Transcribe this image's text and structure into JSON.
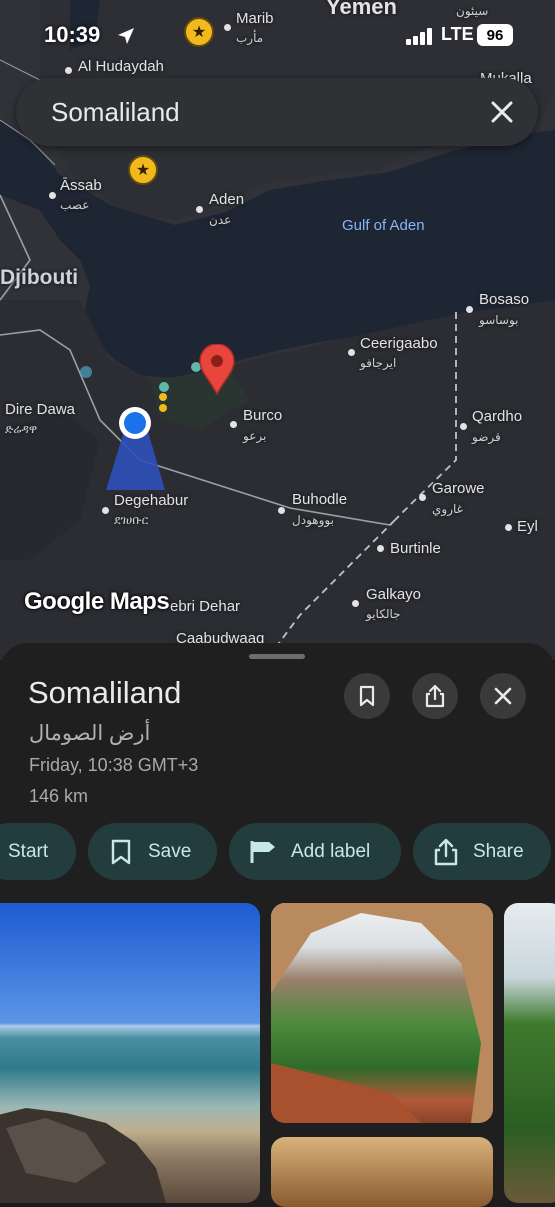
{
  "status_bar": {
    "time": "10:39",
    "network": "LTE",
    "battery": "96"
  },
  "search": {
    "query": "Somaliland"
  },
  "map": {
    "labels": {
      "yemen": "Yemen",
      "seiyun_ar": "سيئون",
      "marib": "Marib",
      "marib_ar": "مأرب",
      "hudaydah": "Al Hudaydah",
      "mukalla": "Mukalla",
      "assab": "Āssab",
      "assab_ar": "عصب",
      "aden": "Aden",
      "aden_ar": "عدن",
      "gulf": "Gulf of Aden",
      "djibouti": "Djibouti",
      "bosaso": "Bosaso",
      "bosaso_ar": "بوساسو",
      "ceerigaabo": "Ceerigaabo",
      "ceerigaabo_ar": "ايرجافو",
      "diredawa": "Dire Dawa",
      "diredawa_am": "ድሬዳዋ",
      "burco": "Burco",
      "burco_ar": "برعو",
      "qardho": "Qardho",
      "qardho_ar": "قرضو",
      "garowe": "Garowe",
      "garowe_ar": "غاروي",
      "eyl": "Eyl",
      "degehabur": "Degehabur",
      "degehabur_am": "ደገሀቡር",
      "buhodle": "Buhodle",
      "buhodle_ar": "بووهودل",
      "burtinle": "Burtinle",
      "galkayo": "Galkayo",
      "galkayo_ar": "جالكايو",
      "kebri_dehar": "ebri Dehar",
      "caabudwaaq": "Caabudwaaq"
    },
    "watermark": "Google Maps"
  },
  "place": {
    "name": "Somaliland",
    "name_ar": "أرض الصومال",
    "local_time": "Friday, 10:38 GMT+3",
    "distance": "146 km"
  },
  "actions": {
    "start": "Start",
    "save": "Save",
    "add_label": "Add label",
    "share": "Share"
  },
  "icons": [
    "search-clear-icon",
    "bookmark-icon",
    "share-icon",
    "close-icon",
    "flag-icon",
    "location-pin-icon",
    "my-location-icon",
    "star-icon"
  ],
  "colors": {
    "water": "#1d2433",
    "land": "#2f3136",
    "pin": "#e8453c",
    "my_location": "#1a73e8",
    "chip_bg": "#233d3e",
    "chip_text": "#c6e8e9",
    "star": "#f2b91d"
  }
}
